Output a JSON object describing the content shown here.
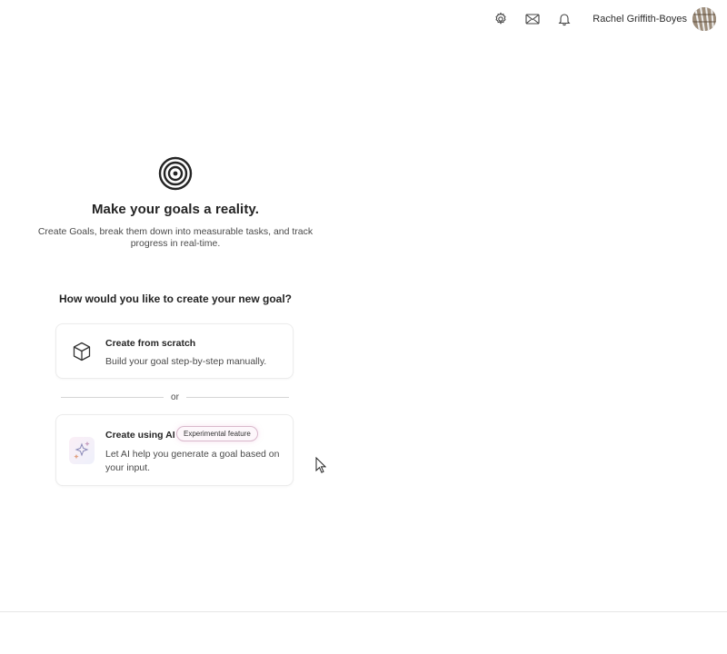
{
  "header": {
    "icons": [
      "settings-icon",
      "mail-icon",
      "bell-icon"
    ],
    "user_name": "Rachel Griffith-Boyes"
  },
  "hero": {
    "icon": "target-icon",
    "title": "Make your goals a reality.",
    "subtitle": "Create Goals, break them down into measurable tasks, and track progress in real-time."
  },
  "question": "How would you like to create your new goal?",
  "options": {
    "scratch": {
      "icon": "cube-icon",
      "title": "Create from scratch",
      "description": "Build your goal step-by-step manually."
    },
    "divider_text": "or",
    "ai": {
      "icon": "sparkle-icon",
      "title": "Create using AI",
      "badge": "Experimental feature",
      "description": "Let AI help you generate a goal based on your input."
    }
  },
  "colors": {
    "text": "#242424",
    "subtext": "#4a4a4a",
    "border": "#ececec",
    "badge_border": "#d9b9cc"
  }
}
